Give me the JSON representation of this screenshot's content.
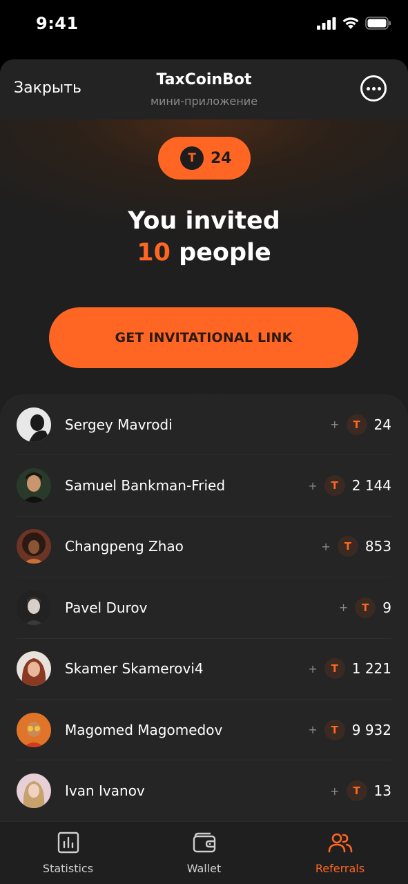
{
  "status_bar": {
    "time": "9:41"
  },
  "header": {
    "close_label": "Закрыть",
    "title": "TaxCoinBot",
    "subtitle": "мини-приложение"
  },
  "balance": {
    "coin_symbol": "T",
    "value": "24"
  },
  "invite": {
    "line1": "You invited",
    "count": "10",
    "people_label": "people",
    "button_label": "GET INVITATIONAL LINK"
  },
  "referrals": [
    {
      "name": "Sergey Mavrodi",
      "plus": "+",
      "coin": "T",
      "amount": "24"
    },
    {
      "name": "Samuel Bankman-Fried",
      "plus": "+",
      "coin": "T",
      "amount": "2 144"
    },
    {
      "name": "Changpeng Zhao",
      "plus": "+",
      "coin": "T",
      "amount": "853"
    },
    {
      "name": "Pavel Durov",
      "plus": "+",
      "coin": "T",
      "amount": "9"
    },
    {
      "name": "Skamer Skamerovi4",
      "plus": "+",
      "coin": "T",
      "amount": "1 221"
    },
    {
      "name": "Magomed Magomedov",
      "plus": "+",
      "coin": "T",
      "amount": "9 932"
    },
    {
      "name": "Ivan Ivanov",
      "plus": "+",
      "coin": "T",
      "amount": "13"
    }
  ],
  "tabs": [
    {
      "label": "Statistics",
      "icon": "chart-icon",
      "active": false
    },
    {
      "label": "Wallet",
      "icon": "wallet-icon",
      "active": false
    },
    {
      "label": "Referrals",
      "icon": "users-icon",
      "active": true
    }
  ],
  "colors": {
    "accent": "#ff6624",
    "background": "#1f1f1f",
    "list_background": "#252525"
  }
}
